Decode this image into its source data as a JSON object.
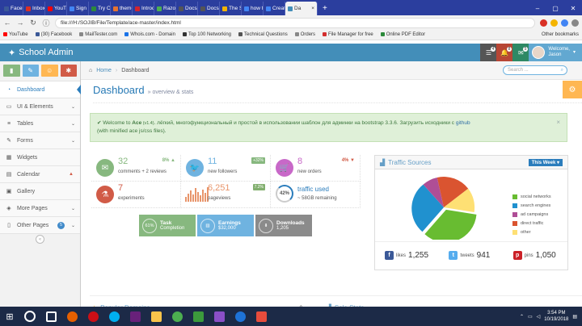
{
  "browser": {
    "tabs": [
      {
        "label": "Faceb",
        "color": "#3b5998"
      },
      {
        "label": "Inbox (",
        "color": "#d93025"
      },
      {
        "label": "YouTub",
        "color": "#ff0000"
      },
      {
        "label": "Sign in",
        "color": "#4285f4"
      },
      {
        "label": "Try Onl",
        "color": "#2c8a3b"
      },
      {
        "label": "themel",
        "color": "#e6732f"
      },
      {
        "label": "Introdu",
        "color": "#d1242f"
      },
      {
        "label": "Razor P",
        "color": "#4caf50"
      },
      {
        "label": "Docs/C",
        "color": "#555555"
      },
      {
        "label": "Docs/C",
        "color": "#555555"
      },
      {
        "label": "The Sel",
        "color": "#f4b400"
      },
      {
        "label": "how to",
        "color": "#4285f4"
      },
      {
        "label": "Create",
        "color": "#4285f4"
      },
      {
        "label": "Da",
        "color": "#438eb9"
      }
    ],
    "new_tab": "+",
    "url": "file:///H:/SOJIB/File/Template/ace-master/index.html",
    "bookmarks": [
      {
        "label": "YouTube",
        "color": "#ff0000"
      },
      {
        "label": "(30) Facebook",
        "color": "#3b5998"
      },
      {
        "label": "MailTester.com",
        "color": "#888888"
      },
      {
        "label": "Whois.com - Domain",
        "color": "#1a73e8"
      },
      {
        "label": "Top 100 Networking",
        "color": "#333333"
      },
      {
        "label": "Technical Questions",
        "color": "#555555"
      },
      {
        "label": "Orders",
        "color": "#888888"
      },
      {
        "label": "File Manager for free",
        "color": "#d32f2f"
      },
      {
        "label": "Online PDF Editor",
        "color": "#2c8a3b"
      }
    ],
    "other_bookmarks": "Other bookmarks"
  },
  "navbar": {
    "brand": "School Admin",
    "badges": [
      "4",
      "8",
      "5"
    ],
    "welcome": "Welcome,",
    "username": "Jason"
  },
  "sidebar": {
    "items": [
      {
        "label": "Dashboard",
        "icon": "tachometer-icon",
        "glyph": "◔"
      },
      {
        "label": "UI & Elements",
        "icon": "desktop-icon",
        "glyph": "▭"
      },
      {
        "label": "Tables",
        "icon": "list-icon",
        "glyph": "≡"
      },
      {
        "label": "Forms",
        "icon": "edit-icon",
        "glyph": "✎"
      },
      {
        "label": "Widgets",
        "icon": "widgets-icon",
        "glyph": "▦"
      },
      {
        "label": "Calendar",
        "icon": "calendar-icon",
        "glyph": "▤"
      },
      {
        "label": "Gallery",
        "icon": "picture-icon",
        "glyph": "▣"
      },
      {
        "label": "More Pages",
        "icon": "tag-icon",
        "glyph": "◈"
      },
      {
        "label": "Other Pages",
        "icon": "file-icon",
        "glyph": "▯",
        "count": "5"
      }
    ],
    "shortcut_colors": [
      "#87b87f",
      "#6fb3e0",
      "#ffb752",
      "#d15b47"
    ]
  },
  "breadcrumb": {
    "home": "Home",
    "current": "Dashboard"
  },
  "search": {
    "placeholder": "Search ..."
  },
  "page": {
    "title": "Dashboard",
    "subtitle": "» overview & stats"
  },
  "alert": {
    "pre": "Welcome to ",
    "brand": "Ace",
    "version": " (v1.4)",
    "text": ". лёгкий, многофункциональный и простой в использовании шаблон для админки на bootstrap 3.3.6. Загрузить исходники с ",
    "link": "github",
    "post": "(with minified ace js/css files)."
  },
  "stats": [
    {
      "num": "32",
      "label": "comments + 2 reviews",
      "pct": "8%",
      "color": "#87b87f"
    },
    {
      "num": "11",
      "label": "new followers",
      "badge": "+32%",
      "color": "#6fb3e0"
    },
    {
      "num": "8",
      "label": "new orders",
      "pct": "4%",
      "color": "#c868c8"
    },
    {
      "num": "7",
      "label": "experiments",
      "color": "#d15b47"
    },
    {
      "num": "6,251",
      "label": "pageviews",
      "badge": "7.2%",
      "color": "#e8956b"
    },
    {
      "num": "traffic used",
      "label": "~ 58GB remaining",
      "circ": "42%",
      "color": "#2b7dbc"
    }
  ],
  "buttons": [
    {
      "pct": "61%",
      "t1": "Task",
      "t2": "Completion",
      "color": "#87b87f"
    },
    {
      "pct": "▥",
      "t1": "Earnings",
      "t2": "$32,000",
      "color": "#6fb3e0"
    },
    {
      "pct": "⬇",
      "t1": "Downloads",
      "t2": "1,205",
      "color": "#8b8b8b"
    }
  ],
  "traffic": {
    "title": "Traffic Sources",
    "period": "This Week",
    "legend": [
      {
        "label": "social networks",
        "color": "#68bc31"
      },
      {
        "label": "search engines",
        "color": "#2091cf"
      },
      {
        "label": "ad campaigns",
        "color": "#af4e96"
      },
      {
        "label": "direct traffic",
        "color": "#da5430"
      },
      {
        "label": "other",
        "color": "#fee074"
      }
    ],
    "footer": [
      {
        "label": "likes",
        "value": "1,255",
        "glyph": "f",
        "color": "#3b5998"
      },
      {
        "label": "tweets",
        "value": "941",
        "glyph": "t",
        "color": "#55acee"
      },
      {
        "label": "pins",
        "value": "1,050",
        "glyph": "p",
        "color": "#cb2027"
      }
    ]
  },
  "bottom": {
    "left": "Popular Domains",
    "right": "Sale Stats"
  },
  "taskbar": {
    "time": "3:54 PM",
    "date": "10/19/2018"
  }
}
